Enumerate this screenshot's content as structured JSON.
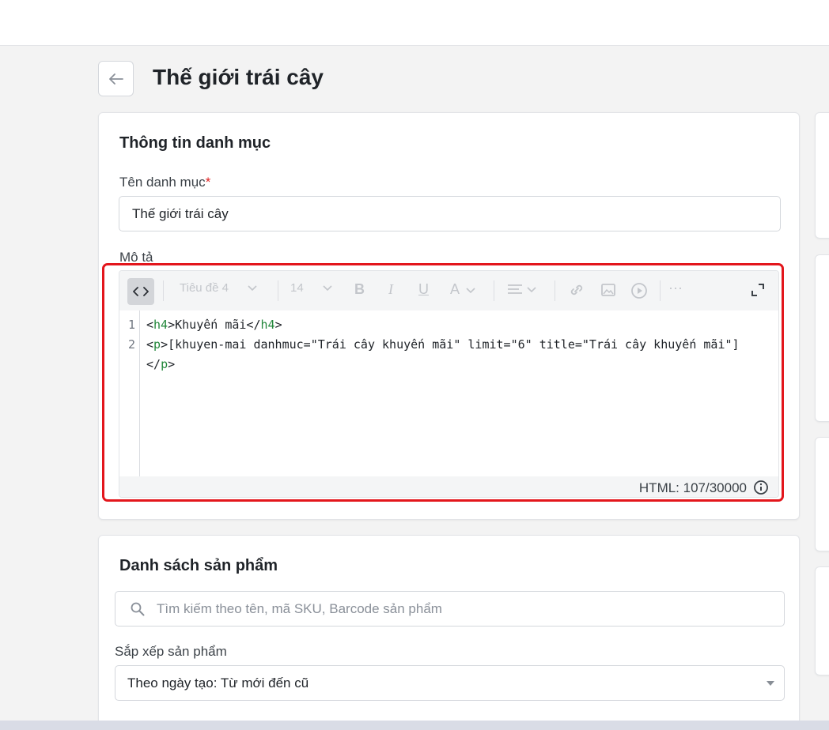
{
  "page": {
    "title": "Thế giới trái cây",
    "back_icon": "arrow-left-icon"
  },
  "info_card": {
    "title": "Thông tin danh mục",
    "name_label": "Tên danh mục",
    "name_required": "*",
    "name_value": "Thế giới trái cây",
    "description_label": "Mô tả"
  },
  "editor": {
    "toolbar": {
      "code_view": "code-view-icon",
      "heading": "Tiêu đề 4",
      "font_size": "14",
      "bold": "B",
      "italic": "I",
      "underline": "U",
      "text_color": "A",
      "align_icon": "align-left-icon",
      "link_icon": "link-icon",
      "image_icon": "image-icon",
      "video_icon": "video-play-icon",
      "more": "···",
      "fullscreen_icon": "fullscreen-icon"
    },
    "code_lines": [
      {
        "number": "1",
        "text": "<h4>Khuyến mãi</h4>"
      },
      {
        "number": "2",
        "text": "<p>[khuyen-mai danhmuc=\"Trái cây khuyến mãi\" limit=\"6\" title=\"Trái cây khuyến mãi\"]"
      },
      {
        "number": "",
        "text": "</p>"
      }
    ],
    "html_count": "HTML: 107/30000"
  },
  "products_card": {
    "title": "Danh sách sản phẩm",
    "search_placeholder": "Tìm kiếm theo tên, mã SKU, Barcode sản phẩm",
    "sort_label": "Sắp xếp sản phẩm",
    "sort_value": "Theo ngày tạo: Từ mới đến cũ"
  },
  "colors": {
    "highlight": "#e3161c",
    "tag": "#22863a",
    "required": "#e02424"
  }
}
